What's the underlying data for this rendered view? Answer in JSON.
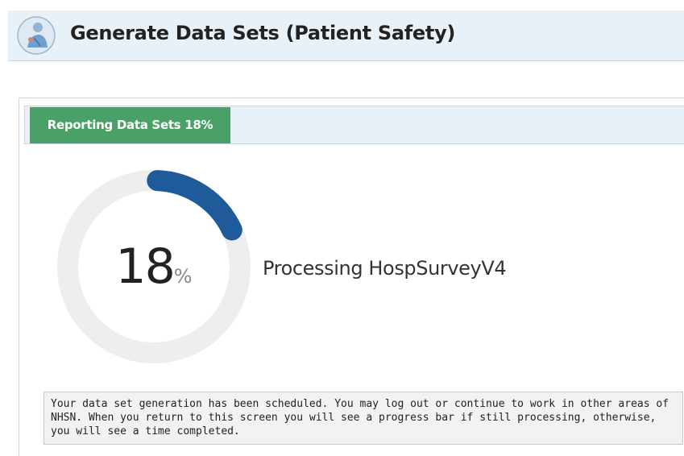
{
  "header": {
    "title": "Generate Data Sets (Patient Safety)",
    "icon": "patient-safety-icon"
  },
  "tab": {
    "label": "Reporting Data Sets  18%"
  },
  "progress": {
    "value": 18,
    "number": "18",
    "unit": "%",
    "status": "Processing HospSurveyV4",
    "colors": {
      "track": "#eeeeee",
      "fill": "#1f5a9a"
    }
  },
  "info": {
    "message": "Your data set generation has been scheduled. You may log out or continue to work in other areas of NHSN. When you return to this screen you will see a progress bar if still processing, otherwise, you will see a time completed."
  },
  "colors": {
    "header_bg": "#e8f0f8",
    "tab_active": "#4aa168"
  }
}
